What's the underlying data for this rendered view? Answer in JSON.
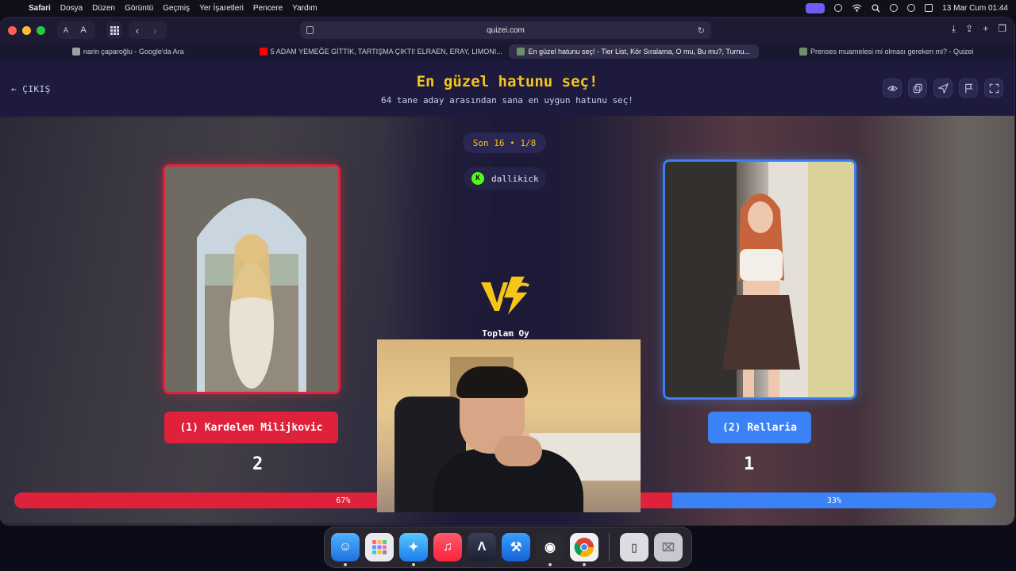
{
  "menubar": {
    "apple": "",
    "items": [
      "Safari",
      "Dosya",
      "Düzen",
      "Görüntü",
      "Geçmiş",
      "Yer İşaretleri",
      "Pencere",
      "Yardım"
    ],
    "clock": "13 Mar Cum  01:44"
  },
  "browser": {
    "url": "quizei.com",
    "toolbar": {
      "text_small": "A",
      "text_large": "A"
    },
    "tabs": [
      {
        "label": "narin çaparoğlu - Google'da Ara",
        "favicon_color": "#9aa0a6"
      },
      {
        "label": "5 ADAM YEMEĞE GİTTİK, TARTIŞMA ÇIKTI! ELRAEN, ERAY, LIMONI...",
        "favicon_color": "#ff0000"
      },
      {
        "label": "En güzel hatunu seç! - Tier List, Kör Sıralama, O mu, Bu mu?, Turnu...",
        "favicon_color": "#6b8f6b"
      },
      {
        "label": "Prenses muamelesi mi olması gereken mi? - Quizei",
        "favicon_color": "#6b8f6b"
      }
    ]
  },
  "page": {
    "back_label": "ÇIKIŞ",
    "title": "En güzel hatunu seç!",
    "subtitle": "64 tane aday arasından sana en uygun hatunu seç!",
    "round": "Son 16 • 1/8",
    "username": "dallikick",
    "total_votes_label": "Toplam Oy"
  },
  "candidates": {
    "left": {
      "name": "(1) Kardelen Milijkovic",
      "votes": "2",
      "percent_label": "67%",
      "percent": 0.67,
      "color": "#e0213b"
    },
    "right": {
      "name": "(2) Rellaria",
      "votes": "1",
      "percent_label": "33%",
      "percent": 0.33,
      "color": "#3b82f6"
    }
  },
  "colors": {
    "accent_yellow": "#f5c518",
    "red": "#e0213b",
    "blue": "#3b82f6",
    "kick_green": "#53fc18"
  },
  "dock": {
    "apps": [
      "finder-icon",
      "launchpad-icon",
      "safari-icon",
      "music-icon",
      "instruments-icon",
      "xcode-icon",
      "obs-icon",
      "chrome-icon",
      "downloads-icon",
      "trash-icon"
    ]
  }
}
